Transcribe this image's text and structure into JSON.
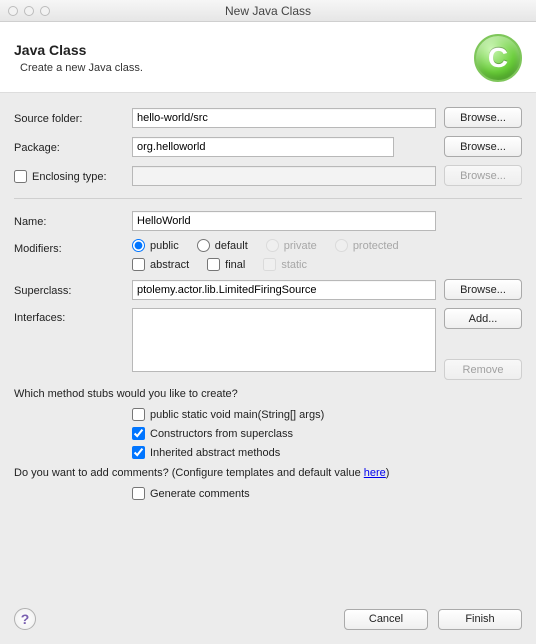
{
  "window": {
    "title": "New Java Class"
  },
  "header": {
    "title": "Java Class",
    "subtitle": "Create a new Java class.",
    "icon_letter": "C"
  },
  "sourceFolder": {
    "label": "Source folder:",
    "value": "hello-world/src",
    "browse": "Browse..."
  },
  "pkg": {
    "label": "Package:",
    "value": "org.helloworld",
    "browse": "Browse..."
  },
  "enclosing": {
    "label": "Enclosing type:",
    "value": "",
    "browse": "Browse..."
  },
  "name": {
    "label": "Name:",
    "value": "HelloWorld"
  },
  "modifiers": {
    "label": "Modifiers:",
    "public": "public",
    "default": "default",
    "private": "private",
    "protected": "protected",
    "abstract": "abstract",
    "final": "final",
    "static": "static"
  },
  "superclass": {
    "label": "Superclass:",
    "value": "ptolemy.actor.lib.LimitedFiringSource",
    "browse": "Browse..."
  },
  "interfaces": {
    "label": "Interfaces:",
    "add": "Add...",
    "remove": "Remove"
  },
  "stubs": {
    "question": "Which method stubs would you like to create?",
    "main": "public static void main(String[] args)",
    "superctor": "Constructors from superclass",
    "inherited": "Inherited abstract methods"
  },
  "comments": {
    "question_prefix": "Do you want to add comments? (Configure templates and default value ",
    "link": "here",
    "question_suffix": ")",
    "generate": "Generate comments"
  },
  "footer": {
    "cancel": "Cancel",
    "finish": "Finish"
  }
}
